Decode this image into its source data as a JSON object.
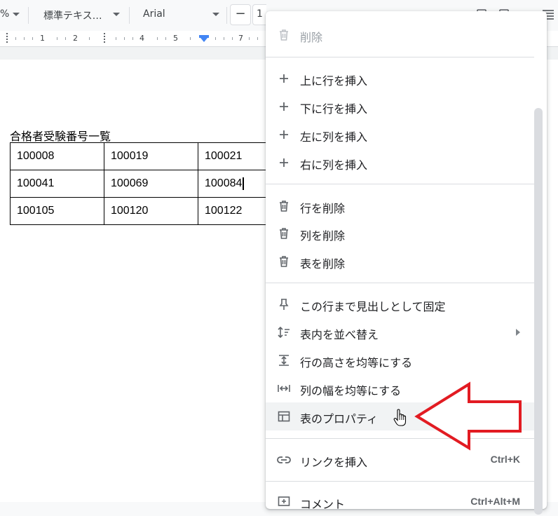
{
  "toolbar": {
    "zoom_suffix": "%",
    "style_label": "標準テキス…",
    "font_label": "Arial",
    "minus_label": "−",
    "size_value": "1"
  },
  "ruler": {
    "numbers": [
      "1",
      "2",
      "4",
      "5",
      "7"
    ]
  },
  "document": {
    "title": "合格者受験番号一覧",
    "table": [
      [
        "100008",
        "100019",
        "100021"
      ],
      [
        "100041",
        "100069",
        "100084"
      ],
      [
        "100105",
        "100120",
        "100122"
      ]
    ]
  },
  "menu": {
    "delete": "削除",
    "insert_row_above": "上に行を挿入",
    "insert_row_below": "下に行を挿入",
    "insert_col_left": "左に列を挿入",
    "insert_col_right": "右に列を挿入",
    "delete_row": "行を削除",
    "delete_col": "列を削除",
    "delete_table": "表を削除",
    "pin_header": "この行まで見出しとして固定",
    "sort_table": "表内を並べ替え",
    "equalize_rows": "行の高さを均等にする",
    "equalize_cols": "列の幅を均等にする",
    "table_properties": "表のプロパティ",
    "insert_link": "リンクを挿入",
    "insert_link_shortcut": "Ctrl+K",
    "comment": "コメント",
    "comment_shortcut": "Ctrl+Alt+M"
  },
  "colors": {
    "arrow": "#e21b22",
    "highlight": "#f1f3f4",
    "ruler_marker": "#4285f4"
  }
}
